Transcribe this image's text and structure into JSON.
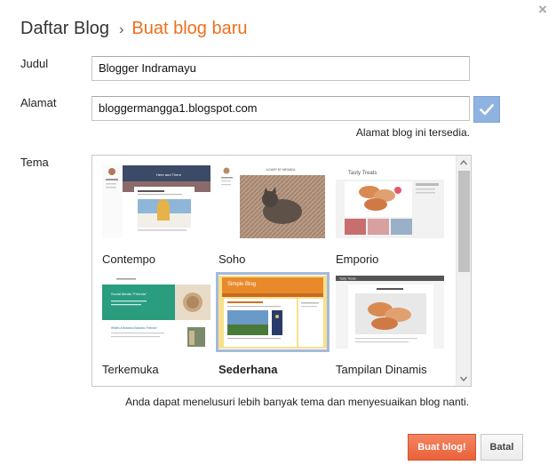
{
  "header": {
    "breadcrumb_root": "Daftar Blog",
    "separator": "›",
    "current": "Buat blog baru"
  },
  "form": {
    "title_label": "Judul",
    "title_value": "Blogger Indramayu",
    "address_label": "Alamat",
    "address_value": "bloggermangga1.blogspot.com",
    "address_status": "Alamat blog ini tersedia.",
    "theme_label": "Tema"
  },
  "themes": [
    {
      "name": "Contempo",
      "selected": false
    },
    {
      "name": "Soho",
      "selected": false
    },
    {
      "name": "Emporio",
      "selected": false
    },
    {
      "name": "Terkemuka",
      "selected": false
    },
    {
      "name": "Sederhana",
      "selected": true
    },
    {
      "name": "Tampilan Dinamis",
      "selected": false
    }
  ],
  "thumbs": {
    "contempo_heading": "Here and There",
    "soho_heading": "A DIARY BY MIRANDA",
    "emporio_heading": "Tasty Treats",
    "terkemuka_heading": "Social Media \"Friends\"",
    "terkemuka_post": "What's a Botanica Botanico Friends?",
    "sederhana_heading": "Simple Blog",
    "dinamis_heading": "Tasty Treats"
  },
  "theme_note": "Anda dapat menelusuri lebih banyak tema dan menyesuaikan blog nanti.",
  "buttons": {
    "create": "Buat blog!",
    "cancel": "Batal"
  },
  "icons": {
    "close": "close-icon",
    "check": "check-icon"
  },
  "colors": {
    "accent": "#ee6f1e",
    "primary_button": "#f06c43",
    "check_button": "#8fb3e0",
    "selection": "#a6b9dd"
  }
}
